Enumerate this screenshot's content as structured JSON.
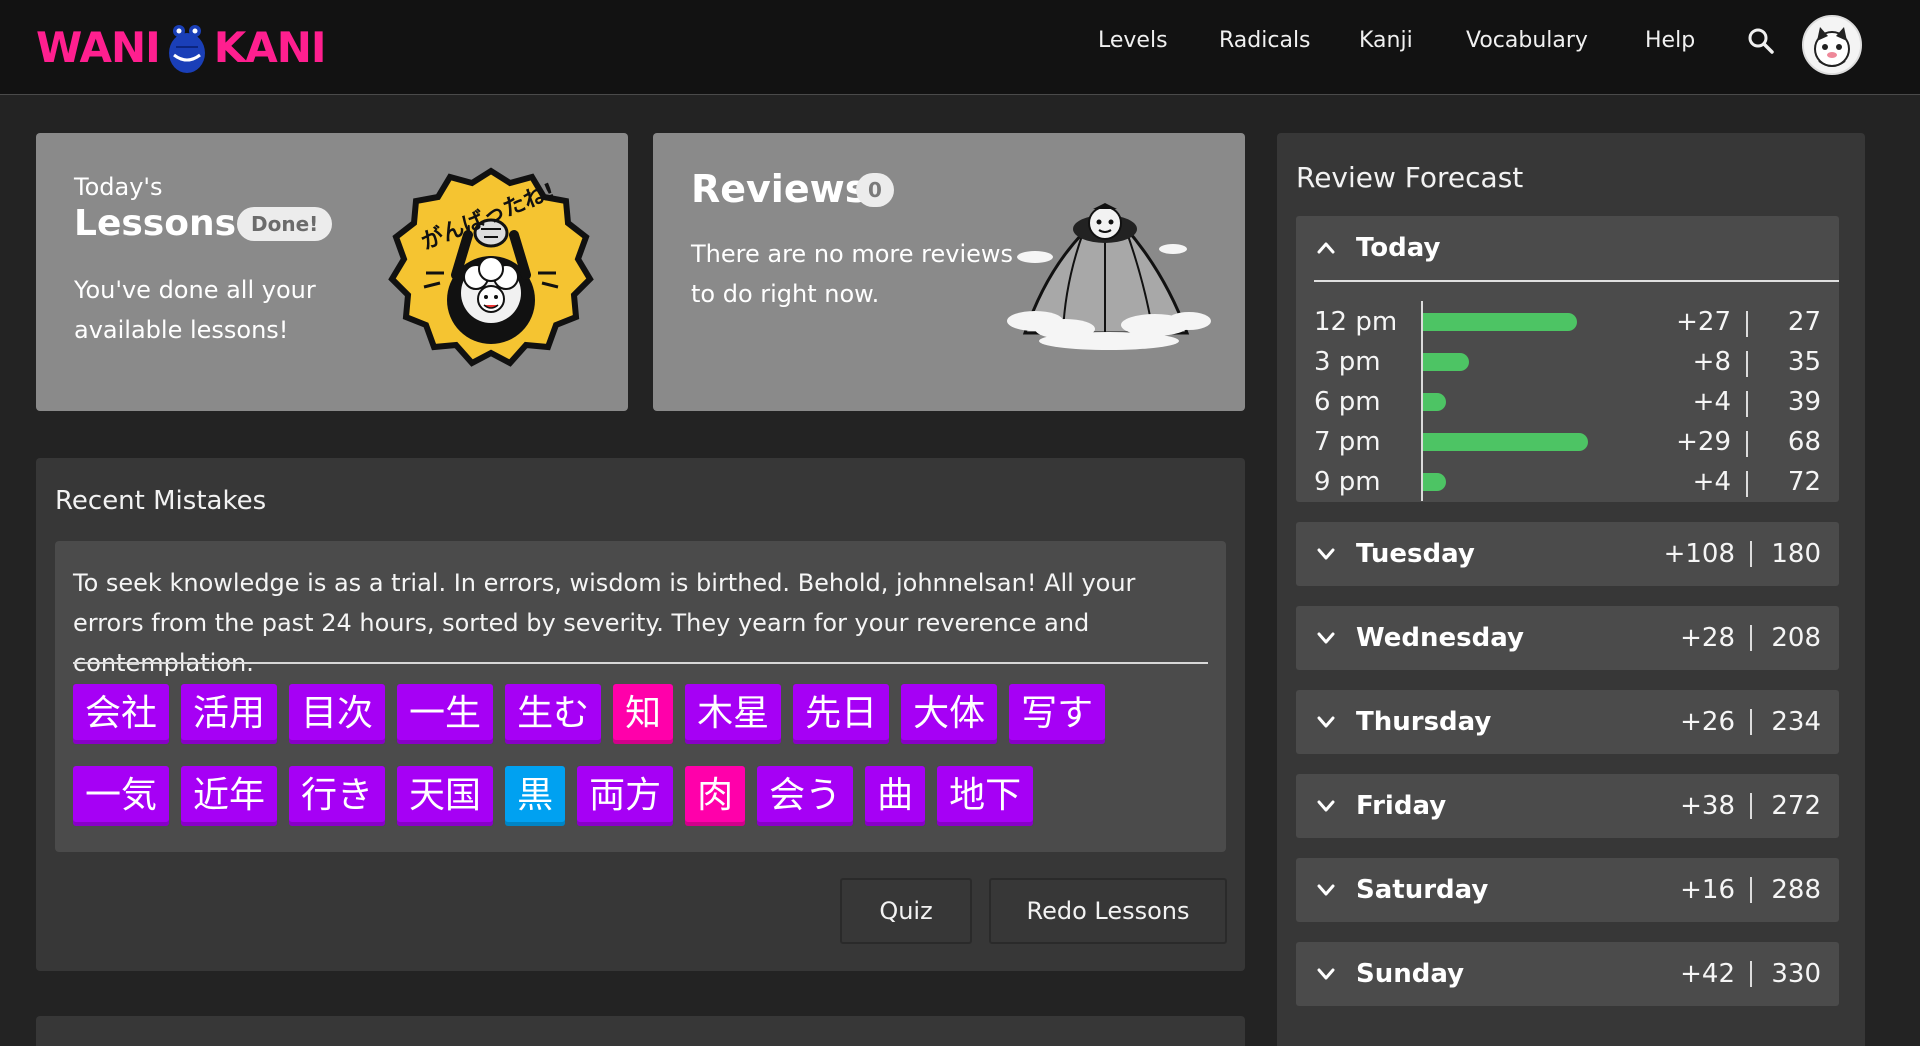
{
  "header": {
    "logo_text_left": "WANI",
    "logo_text_right": "KANI",
    "nav": [
      "Levels",
      "Radicals",
      "Kanji",
      "Vocabulary",
      "Help"
    ],
    "accent_color": "#ff1f8f"
  },
  "lessons": {
    "kicker": "Today's",
    "title": "Lessons",
    "badge": "Done!",
    "message": "You've done all your available lessons!",
    "art_text": "がんばったね!"
  },
  "reviews": {
    "title": "Reviews",
    "count": "0",
    "message": "There are no more reviews to do right now."
  },
  "mistakes": {
    "heading": "Recent Mistakes",
    "text": "To seek knowledge is as a trial. In errors, wisdom is birthed. Behold, johnnelsan! All your errors from the past 24 hours, sorted by severity. They yearn for your reverence and contemplation.",
    "row1": [
      {
        "text": "会社",
        "type": "vocabulary"
      },
      {
        "text": "活用",
        "type": "vocabulary"
      },
      {
        "text": "目次",
        "type": "vocabulary"
      },
      {
        "text": "一生",
        "type": "vocabulary"
      },
      {
        "text": "生む",
        "type": "vocabulary"
      },
      {
        "text": "知",
        "type": "kanji"
      },
      {
        "text": "木星",
        "type": "vocabulary"
      },
      {
        "text": "先日",
        "type": "vocabulary"
      },
      {
        "text": "大体",
        "type": "vocabulary"
      },
      {
        "text": "写す",
        "type": "vocabulary"
      }
    ],
    "row2": [
      {
        "text": "一気",
        "type": "vocabulary"
      },
      {
        "text": "近年",
        "type": "vocabulary"
      },
      {
        "text": "行き",
        "type": "vocabulary"
      },
      {
        "text": "天国",
        "type": "vocabulary"
      },
      {
        "text": "黒",
        "type": "radical"
      },
      {
        "text": "両方",
        "type": "vocabulary"
      },
      {
        "text": "肉",
        "type": "kanji"
      },
      {
        "text": "会う",
        "type": "vocabulary"
      },
      {
        "text": "曲",
        "type": "vocabulary"
      },
      {
        "text": "地下",
        "type": "vocabulary"
      }
    ],
    "quiz_label": "Quiz",
    "redo_label": "Redo Lessons"
  },
  "forecast": {
    "heading": "Review Forecast",
    "today_label": "Today",
    "today": [
      {
        "time": "12 pm",
        "add": "+27",
        "total": "27"
      },
      {
        "time": "3 pm",
        "add": "+8",
        "total": "35"
      },
      {
        "time": "6 pm",
        "add": "+4",
        "total": "39"
      },
      {
        "time": "7 pm",
        "add": "+29",
        "total": "68"
      },
      {
        "time": "9 pm",
        "add": "+4",
        "total": "72"
      }
    ],
    "days": [
      {
        "day": "Tuesday",
        "add": "+108",
        "total": "180"
      },
      {
        "day": "Wednesday",
        "add": "+28",
        "total": "208"
      },
      {
        "day": "Thursday",
        "add": "+26",
        "total": "234"
      },
      {
        "day": "Friday",
        "add": "+38",
        "total": "272"
      },
      {
        "day": "Saturday",
        "add": "+16",
        "total": "288"
      },
      {
        "day": "Sunday",
        "add": "+42",
        "total": "330"
      }
    ],
    "bar_color": "#4dc464"
  }
}
